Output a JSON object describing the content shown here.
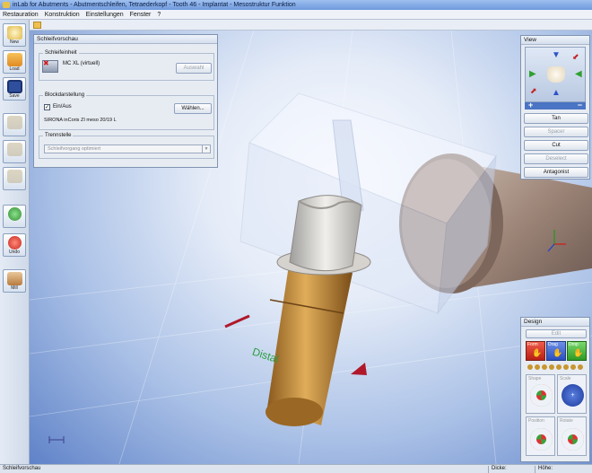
{
  "window": {
    "title": "inLab for Abutments - Abutmentschleifen, Tetraederkopf - Tooth 46 - Implantat - Mesostruktur Funktion"
  },
  "menu": [
    "Restauration",
    "Konstruktion",
    "Einstellungen",
    "Fenster",
    "?"
  ],
  "left_tools": [
    {
      "label": "New",
      "icon": "new-icon",
      "color": "#e9cd6a",
      "enabled": true
    },
    {
      "label": "Load",
      "icon": "folder-icon",
      "color": "#f0a83a",
      "enabled": true
    },
    {
      "label": "Save",
      "icon": "floppy-disk-icon",
      "color": "#2f4f9c",
      "enabled": true
    },
    {
      "label": "",
      "icon": "tooth-icon",
      "color": "#b9a77c",
      "enabled": false
    },
    {
      "label": "",
      "icon": "tooth-icon",
      "color": "#b9a77c",
      "enabled": false
    },
    {
      "label": "",
      "icon": "tooth-icon",
      "color": "#b9a77c",
      "enabled": false
    },
    {
      "label": "",
      "icon": "arrow-right-icon",
      "color": "#3fa83f",
      "enabled": true
    },
    {
      "label": "Undo",
      "icon": "arrow-left-icon",
      "color": "#d23a2b",
      "enabled": true
    },
    {
      "label": "Mill",
      "icon": "mill-icon",
      "color": "#c98e56",
      "enabled": true
    }
  ],
  "grinding_panel": {
    "title": "Schleifvorschau",
    "unit_group": "Schleifeinheit",
    "unit_name": "MC XL (virtuell)",
    "unit_button": "Auswahl",
    "block_group": "Blockdarstellung",
    "block_checkbox": "Ein/Aus",
    "block_checked": true,
    "choose_button": "Wählen...",
    "block_name": "SIRONA inCoris ZI meso 20/19 L",
    "separation_group": "Trennstelle",
    "separation_value": "Schleifvorgang optimiert"
  },
  "view_panel": {
    "title": "View",
    "zoom_in": "+",
    "zoom_out": "−",
    "buttons": [
      {
        "label": "Tan",
        "enabled": true
      },
      {
        "label": "Spacer",
        "enabled": false
      },
      {
        "label": "Cut",
        "enabled": true
      },
      {
        "label": "Deselect",
        "enabled": false
      },
      {
        "label": "Antagonist",
        "enabled": true
      }
    ]
  },
  "design_panel": {
    "title": "Design",
    "top_button": "Edit",
    "tool_row": [
      "Form",
      "Drag",
      "Drop"
    ],
    "tools": [
      "Shape",
      "Scale",
      "Position",
      "Rotate"
    ]
  },
  "viewport": {
    "label_distal": "Distal"
  },
  "statusbar": {
    "left": "Schleifvorschau",
    "dicke": "Dicke:",
    "hoehe": "Höhe:"
  },
  "colors": {
    "accent": "#2b57c8",
    "background": "#7b9ad6",
    "model": "#d49a45",
    "gold": "#c8962f"
  }
}
